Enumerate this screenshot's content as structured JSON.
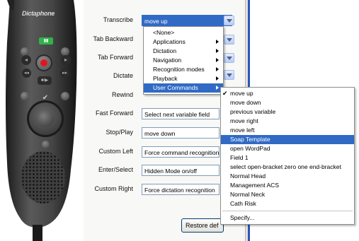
{
  "brand": "Dictaphone",
  "rows": [
    {
      "label": "Transcribe",
      "value": "move up"
    },
    {
      "label": "Tab Backward",
      "value": ""
    },
    {
      "label": "Tab Forward",
      "value": ""
    },
    {
      "label": "Dictate",
      "value": ""
    },
    {
      "label": "Rewind",
      "value": ""
    },
    {
      "label": "Fast Forward",
      "value": "Select next variable field"
    },
    {
      "label": "Stop/Play",
      "value": "move down"
    },
    {
      "label": "Custom Left",
      "value": "Force command recognition"
    },
    {
      "label": "Enter/Select",
      "value": "Hidden Mode on/off"
    },
    {
      "label": "Custom Right",
      "value": "Force dictation recognition"
    }
  ],
  "category_menu": [
    {
      "label": "<None>",
      "submenu": false
    },
    {
      "label": "Applications",
      "submenu": true
    },
    {
      "label": "Dictation",
      "submenu": true
    },
    {
      "label": "Navigation",
      "submenu": true
    },
    {
      "label": "Recognition modes",
      "submenu": true
    },
    {
      "label": "Playback",
      "submenu": true
    },
    {
      "label": "User Commands",
      "submenu": true,
      "highlighted": true
    }
  ],
  "commands_menu": [
    {
      "label": "move up",
      "checked": true
    },
    {
      "label": "move down"
    },
    {
      "label": "previous variable"
    },
    {
      "label": "move right"
    },
    {
      "label": "move left"
    },
    {
      "label": "Soap Template",
      "highlighted": true
    },
    {
      "label": "open WordPad"
    },
    {
      "label": "Field 1"
    },
    {
      "label": "select open-bracket zero one end-bracket"
    },
    {
      "label": "Normal Head"
    },
    {
      "label": "Management ACS"
    },
    {
      "label": "Normal Neck"
    },
    {
      "label": "Cath Risk"
    }
  ],
  "specify_label": "Specify...",
  "restore_button": "Restore def",
  "colors": {
    "highlight": "#316ac5",
    "device_body": "#3a3a3a",
    "record": "#e0161f",
    "led": "#2fb34a"
  }
}
